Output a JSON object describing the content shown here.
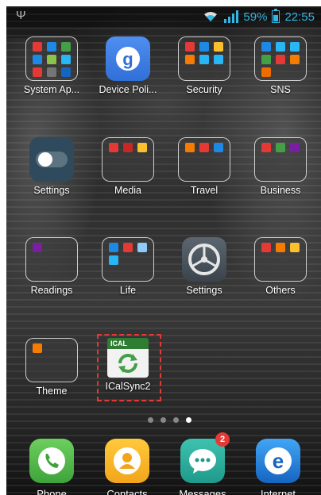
{
  "status_bar": {
    "battery_percent": "59%",
    "time": "22:55",
    "colors": {
      "accent": "#33b5e5"
    },
    "icons": [
      "usb-icon",
      "wifi-icon",
      "signal-icon",
      "battery-icon"
    ]
  },
  "home_grid": [
    {
      "label": "System Ap...",
      "type": "folder"
    },
    {
      "label": "Device Poli...",
      "type": "app",
      "icon": "google-icon"
    },
    {
      "label": "Security",
      "type": "folder"
    },
    {
      "label": "SNS",
      "type": "folder"
    },
    {
      "label": "Settings",
      "type": "app",
      "icon": "toggle-icon"
    },
    {
      "label": "Media",
      "type": "folder"
    },
    {
      "label": "Travel",
      "type": "folder"
    },
    {
      "label": "Business",
      "type": "folder"
    },
    {
      "label": "Readings",
      "type": "folder"
    },
    {
      "label": "Life",
      "type": "folder"
    },
    {
      "label": "Settings",
      "type": "app",
      "icon": "gear-icon"
    },
    {
      "label": "Others",
      "type": "folder"
    },
    {
      "label": "Theme",
      "type": "folder"
    },
    {
      "label": "ICalSync2",
      "type": "app",
      "icon": "ical-sync-icon",
      "icon_text": "ICAL",
      "selected": true
    }
  ],
  "page_indicator": {
    "count": 4,
    "active_index": 3
  },
  "dock": [
    {
      "label": "Phone",
      "icon": "phone-icon",
      "color": "#4caf50"
    },
    {
      "label": "Contacts",
      "icon": "contacts-icon",
      "color": "#f5a623"
    },
    {
      "label": "Messages",
      "icon": "messages-icon",
      "color": "#26a69a",
      "badge": "2"
    },
    {
      "label": "Internet",
      "icon": "internet-icon",
      "color": "#1e88e5"
    }
  ]
}
